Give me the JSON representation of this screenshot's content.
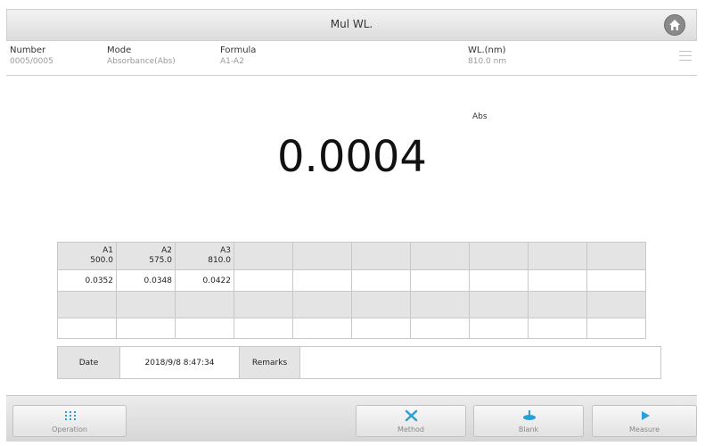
{
  "header": {
    "title": "Mul WL."
  },
  "info": {
    "number_label": "Number",
    "number_value": "0005/0005",
    "mode_label": "Mode",
    "mode_value": "Absorbance(Abs)",
    "formula_label": "Formula",
    "formula_value": "A1-A2",
    "wl_label": "WL.(nm)",
    "wl_value": "810.0 nm"
  },
  "measurement": {
    "unit": "Abs",
    "value": "0.0004"
  },
  "table": {
    "columns": [
      {
        "name": "A1",
        "wl": "500.0",
        "value": "0.0352"
      },
      {
        "name": "A2",
        "wl": "575.0",
        "value": "0.0348"
      },
      {
        "name": "A3",
        "wl": "810.0",
        "value": "0.0422"
      }
    ]
  },
  "footer_info": {
    "date_label": "Date",
    "date_value": "2018/9/8 8:47:34",
    "remarks_label": "Remarks",
    "remarks_value": ""
  },
  "buttons": {
    "operation": "Operation",
    "method": "Method",
    "blank": "Blank",
    "measure": "Measure"
  },
  "colors": {
    "accent": "#2a9fd6",
    "header_bg": "#e0e0e0",
    "grid_gray": "#e4e4e4"
  },
  "icons": {
    "home": "home-icon",
    "menu": "list-icon",
    "operation": "grid-dots-icon",
    "method": "tools-icon",
    "blank": "blank-flask-icon",
    "measure": "play-icon"
  }
}
